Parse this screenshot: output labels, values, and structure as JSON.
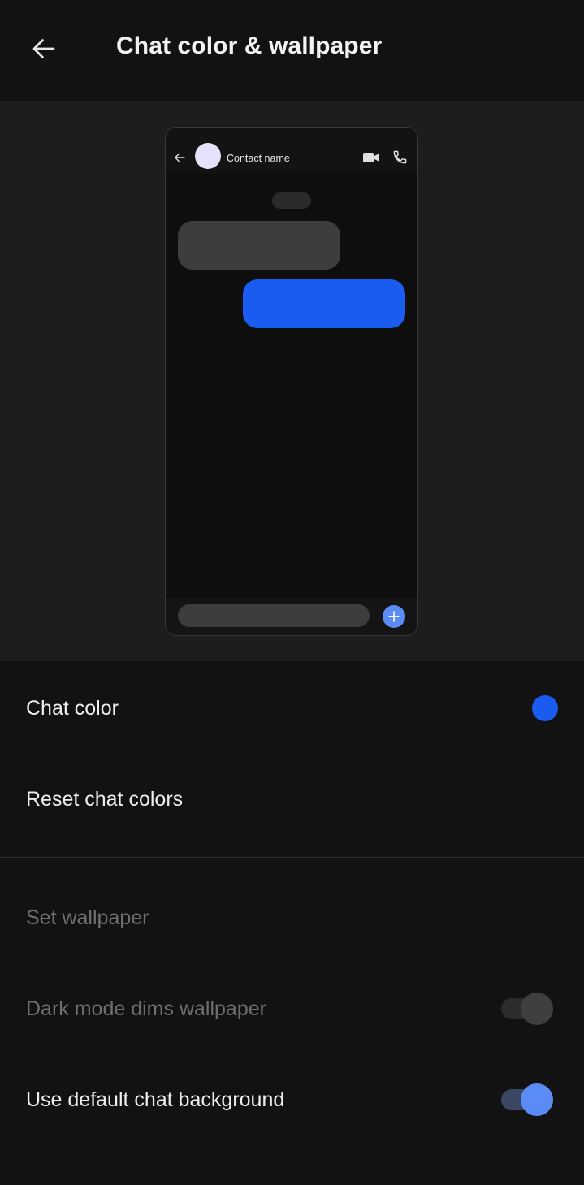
{
  "appbar": {
    "title": "Chat color & wallpaper",
    "back_icon": "arrow-left-icon"
  },
  "preview": {
    "contact_name": "Contact name",
    "icons": [
      "arrow-left-icon",
      "video-camera-icon",
      "phone-icon",
      "plus-icon"
    ],
    "outgoing_bubble_color": "#1a5cf0",
    "incoming_bubble_color": "#3d3d3d",
    "avatar_color": "#e4e3fb"
  },
  "settings": {
    "chat_color": {
      "label": "Chat color",
      "value_color": "#1a5cf0"
    },
    "reset_colors": {
      "label": "Reset chat colors"
    },
    "set_wallpaper": {
      "label": "Set wallpaper",
      "enabled": false
    },
    "dark_mode_dims": {
      "label": "Dark mode dims wallpaper",
      "enabled": false,
      "checked": true
    },
    "default_background": {
      "label": "Use default chat background",
      "enabled": true,
      "checked": true
    }
  }
}
